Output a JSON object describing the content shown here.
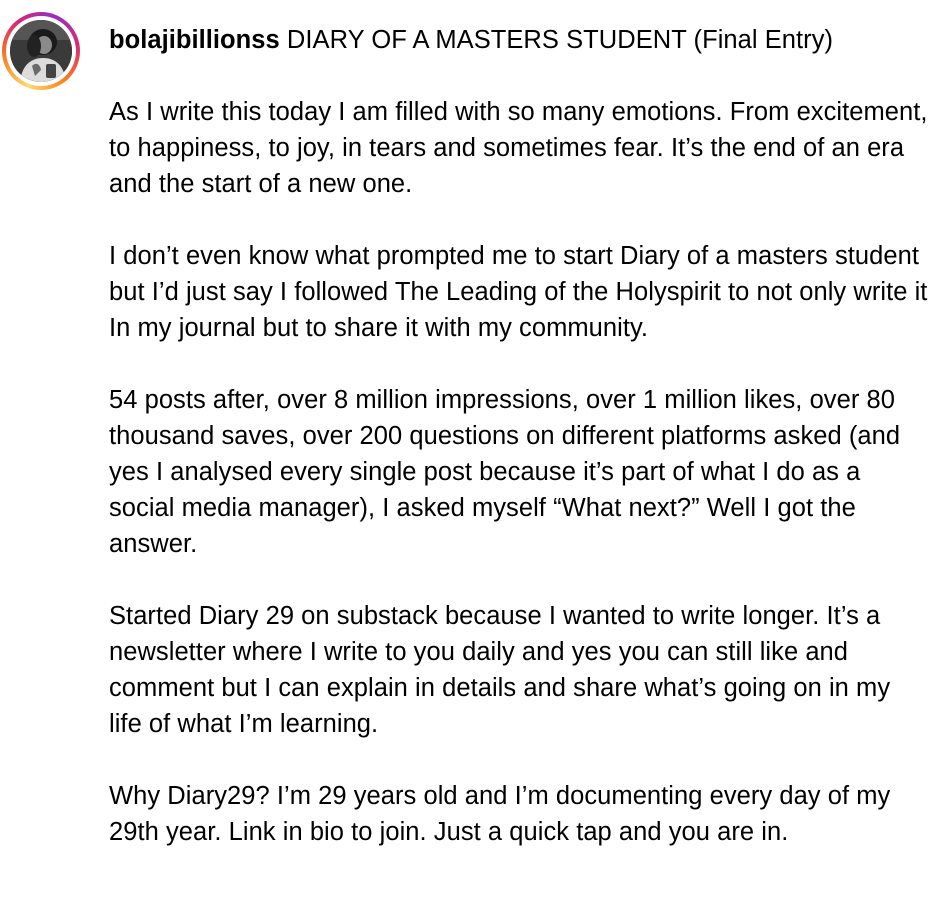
{
  "post": {
    "username": "bolajibillionss",
    "title": "DIARY OF A MASTERS STUDENT (Final Entry)",
    "avatar_icon": "profile-photo",
    "story_ring_colors": [
      "#feda75",
      "#fa7e1e",
      "#d62976",
      "#962fbf"
    ],
    "paragraphs": [
      "As I write this today I am filled with so many emotions. From excitement, to happiness, to joy, in tears and sometimes fear. It’s the end of an era and the start of a new one.",
      "I don’t even know what prompted me to start Diary of a masters student but I’d just say I followed The Leading of the Holyspirit to not only write it In my journal but to share it with my community.",
      "54 posts after, over 8 million impressions, over 1 million likes, over 80 thousand saves, over 200 questions on different platforms asked (and yes I analysed every single post because it’s part of what I do as a social media manager), I asked myself “What next?” Well I got the answer.",
      "Started Diary 29 on substack because I wanted to write longer. It’s a newsletter where I write to you daily and yes you can still like and comment but I can explain in details and share what’s going on in my life of what I’m learning.",
      "Why Diary29? I’m 29 years old and I’m documenting every day of my 29th year. Link in bio to join. Just a quick tap and you are in."
    ]
  }
}
